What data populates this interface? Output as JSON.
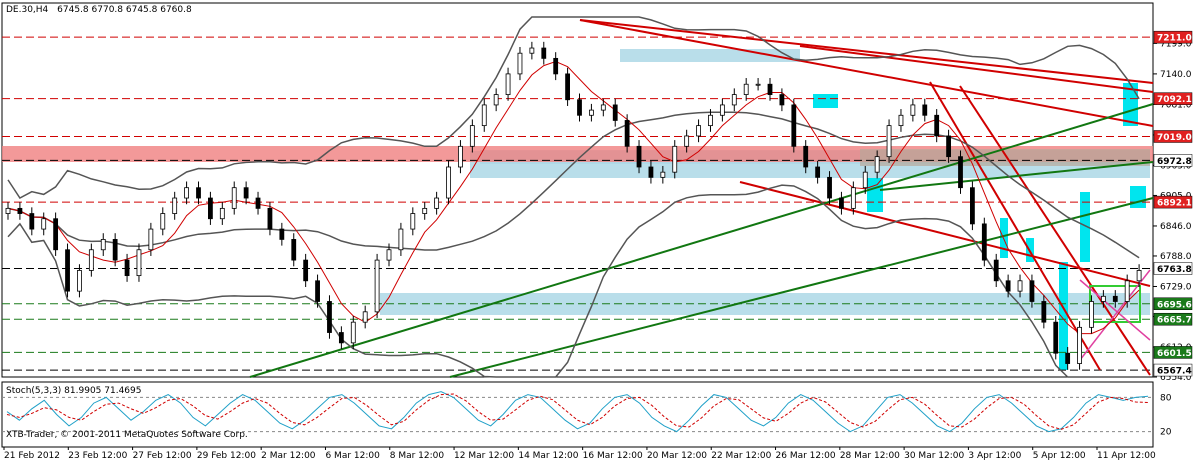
{
  "chart_data": {
    "type": "candlestick",
    "header": {
      "symbol_tf": "DE.30,H4",
      "ohlc": "6745.8 6770.8 6745.8 6760.8"
    },
    "y_range": [
      6554.0,
      7250.0
    ],
    "price_ticks": [
      "7199.0",
      "7140.0",
      "7081.0",
      "7022.0",
      "6963.0",
      "6905.0",
      "6846.0",
      "6788.0",
      "6729.0",
      "6671.0",
      "6612.0",
      "6554.0"
    ],
    "level_labels": [
      {
        "text": "7211.0",
        "value": 7211.0,
        "style": "red"
      },
      {
        "text": "7092.1",
        "value": 7092.1,
        "style": "red"
      },
      {
        "text": "7019.0",
        "value": 7019.0,
        "style": "red"
      },
      {
        "text": "6972.8",
        "value": 6972.8,
        "style": "white"
      },
      {
        "text": "6892.1",
        "value": 6892.1,
        "style": "red"
      },
      {
        "text": "6763.8",
        "value": 6763.8,
        "style": "white"
      },
      {
        "text": "6695.6",
        "value": 6695.6,
        "style": "green"
      },
      {
        "text": "6665.7",
        "value": 6665.7,
        "style": "green"
      },
      {
        "text": "6601.5",
        "value": 6601.5,
        "style": "green"
      },
      {
        "text": "6567.4",
        "value": 6567.4,
        "style": "white"
      }
    ],
    "x_labels": [
      "21 Feb 2012",
      "23 Feb 12:00",
      "27 Feb 12:00",
      "29 Feb 12:00",
      "2 Mar 12:00",
      "6 Mar 12:00",
      "8 Mar 12:00",
      "12 Mar 12:00",
      "14 Mar 12:00",
      "16 Mar 12:00",
      "20 Mar 12:00",
      "22 Mar 12:00",
      "26 Mar 12:00",
      "28 Mar 12:00",
      "30 Mar 12:00",
      "3 Apr 12:00",
      "5 Apr 12:00",
      "11 Apr 12:00"
    ],
    "close_series": [
      6880,
      6870,
      6840,
      6860,
      6800,
      6720,
      6760,
      6800,
      6820,
      6780,
      6750,
      6800,
      6840,
      6870,
      6900,
      6920,
      6900,
      6860,
      6880,
      6920,
      6900,
      6880,
      6840,
      6820,
      6780,
      6740,
      6700,
      6640,
      6620,
      6660,
      6680,
      6780,
      6800,
      6840,
      6870,
      6880,
      6900,
      6960,
      7000,
      7040,
      7080,
      7100,
      7140,
      7180,
      7190,
      7170,
      7140,
      7090,
      7060,
      7070,
      7080,
      7050,
      7000,
      6960,
      6940,
      6950,
      7000,
      7020,
      7040,
      7060,
      7080,
      7100,
      7120,
      7120,
      7100,
      7080,
      7000,
      6960,
      6940,
      6900,
      6880,
      6920,
      6950,
      6980,
      7040,
      7060,
      7080,
      7060,
      7020,
      6980,
      6920,
      6850,
      6780,
      6740,
      6720,
      6740,
      6700,
      6660,
      6600,
      6580,
      6650,
      6700,
      6710,
      6700,
      6740,
      6760
    ],
    "stoch": {
      "title": "Stoch(5,3,3) 81.9905 71.4695",
      "levels": [
        "80",
        "20"
      ],
      "k": [
        55,
        40,
        60,
        75,
        50,
        30,
        45,
        70,
        80,
        60,
        40,
        55,
        75,
        85,
        70,
        45,
        30,
        50,
        70,
        85,
        75,
        55,
        35,
        25,
        40,
        60,
        80,
        85,
        70,
        50,
        30,
        25,
        45,
        70,
        85,
        90,
        80,
        60,
        40,
        30,
        50,
        75,
        85,
        80,
        60,
        40,
        25,
        35,
        60,
        80,
        85,
        70,
        45,
        30,
        20,
        40,
        65,
        85,
        80,
        60,
        40,
        30,
        45,
        70,
        85,
        75,
        55,
        35,
        20,
        30,
        55,
        80,
        85,
        70,
        50,
        30,
        20,
        35,
        60,
        80,
        85,
        70,
        50,
        30,
        20,
        25,
        45,
        70,
        85,
        80,
        75,
        80,
        82
      ],
      "d": [
        50,
        45,
        52,
        62,
        58,
        45,
        40,
        55,
        68,
        70,
        60,
        52,
        62,
        75,
        78,
        65,
        48,
        42,
        55,
        70,
        78,
        70,
        52,
        36,
        32,
        45,
        62,
        78,
        80,
        66,
        48,
        32,
        38,
        58,
        75,
        85,
        86,
        74,
        55,
        40,
        42,
        58,
        75,
        82,
        76,
        58,
        40,
        32,
        45,
        65,
        78,
        80,
        66,
        46,
        30,
        28,
        44,
        65,
        78,
        76,
        60,
        44,
        38,
        52,
        70,
        80,
        72,
        54,
        36,
        28,
        38,
        58,
        76,
        80,
        68,
        48,
        30,
        28,
        42,
        62,
        78,
        80,
        68,
        48,
        30,
        24,
        32,
        52,
        72,
        80,
        78,
        72,
        71
      ]
    },
    "watermark": "XTB-Trader, © 2001-2011 MetaQuotes Software Corp.",
    "colors": {
      "candle_up": "#ffffff",
      "candle_down": "#000000",
      "wick": "#000000",
      "band": "#555555",
      "ma": "#d00000",
      "red_level": "#d00000",
      "green_level": "#1a7a1a",
      "zone": "#add8e6",
      "red_zone": "#f08080",
      "cyan": "#00e5ee",
      "trend_red": "#d00000",
      "trend_green": "#117711",
      "stoch_k": "#1fa0c8",
      "stoch_d": "#d00000",
      "label_red_bg": "#e02020",
      "label_green_bg": "#1a7a1a",
      "label_white_bg": "#ffffff"
    }
  }
}
